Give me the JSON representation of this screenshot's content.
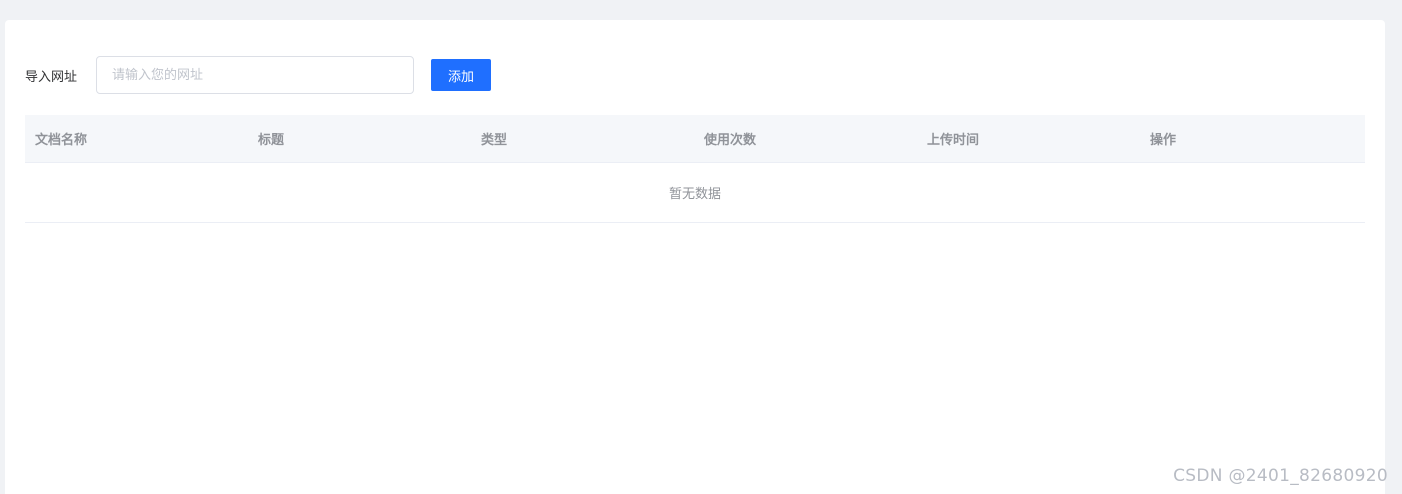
{
  "form": {
    "label": "导入网址",
    "input_value": "",
    "input_placeholder": "请输入您的网址",
    "add_button_label": "添加"
  },
  "table": {
    "columns": [
      "文档名称",
      "标题",
      "类型",
      "使用次数",
      "上传时间",
      "操作"
    ],
    "rows": [],
    "empty_text": "暂无数据"
  },
  "watermark": "CSDN @2401_82680920",
  "colors": {
    "page_background": "#f0f2f5",
    "card_background": "#ffffff",
    "primary_button": "#1f6fff",
    "table_header_background": "#f5f7fa",
    "header_text": "#909399"
  }
}
